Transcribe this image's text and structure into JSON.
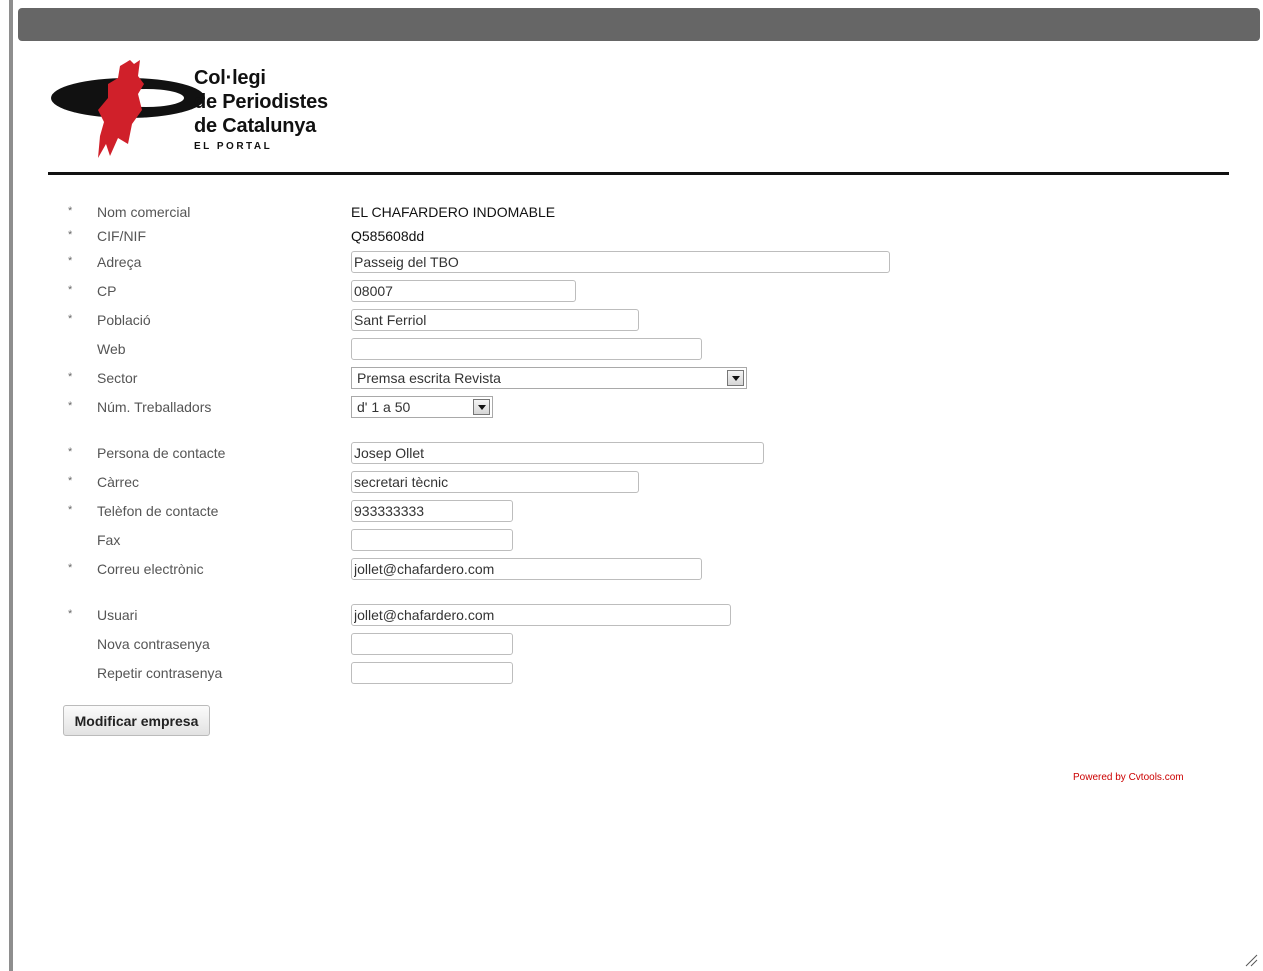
{
  "brand": {
    "lines": [
      "Col·legi",
      "de Periodistes",
      "de Catalunya"
    ],
    "subtitle": "EL PORTAL",
    "colors": {
      "black": "#111111",
      "red": "#d0202a",
      "topbar": "#666666"
    }
  },
  "form": {
    "required_mark": "*",
    "fields": [
      {
        "label": "Nom comercial",
        "value": "EL CHAFARDERO INDOMABLE"
      },
      {
        "label": "CIF/NIF",
        "value": "Q585608dd"
      },
      {
        "label": "Adreça",
        "value": "Passeig del TBO"
      },
      {
        "label": "CP",
        "value": "08007"
      },
      {
        "label": "Població",
        "value": "Sant Ferriol"
      },
      {
        "label": "Web",
        "value": ""
      },
      {
        "label": "Sector",
        "value": "Premsa escrita Revista"
      },
      {
        "label": "Núm. Treballadors",
        "value": "d' 1 a 50"
      },
      {
        "label": "Persona de contacte",
        "value": "Josep Ollet"
      },
      {
        "label": "Càrrec",
        "value": "secretari tècnic"
      },
      {
        "label": "Telèfon de contacte",
        "value": "933333333"
      },
      {
        "label": "Fax",
        "value": ""
      },
      {
        "label": "Correu electrònic",
        "value": "jollet@chafardero.com"
      },
      {
        "label": "Usuari",
        "value": "jollet@chafardero.com"
      },
      {
        "label": "Nova contrasenya",
        "value": ""
      },
      {
        "label": "Repetir contrasenya",
        "value": ""
      }
    ]
  },
  "actions": {
    "submit_label": "Modificar empresa"
  },
  "footer": {
    "powered": "Powered by Cvtools.com"
  }
}
